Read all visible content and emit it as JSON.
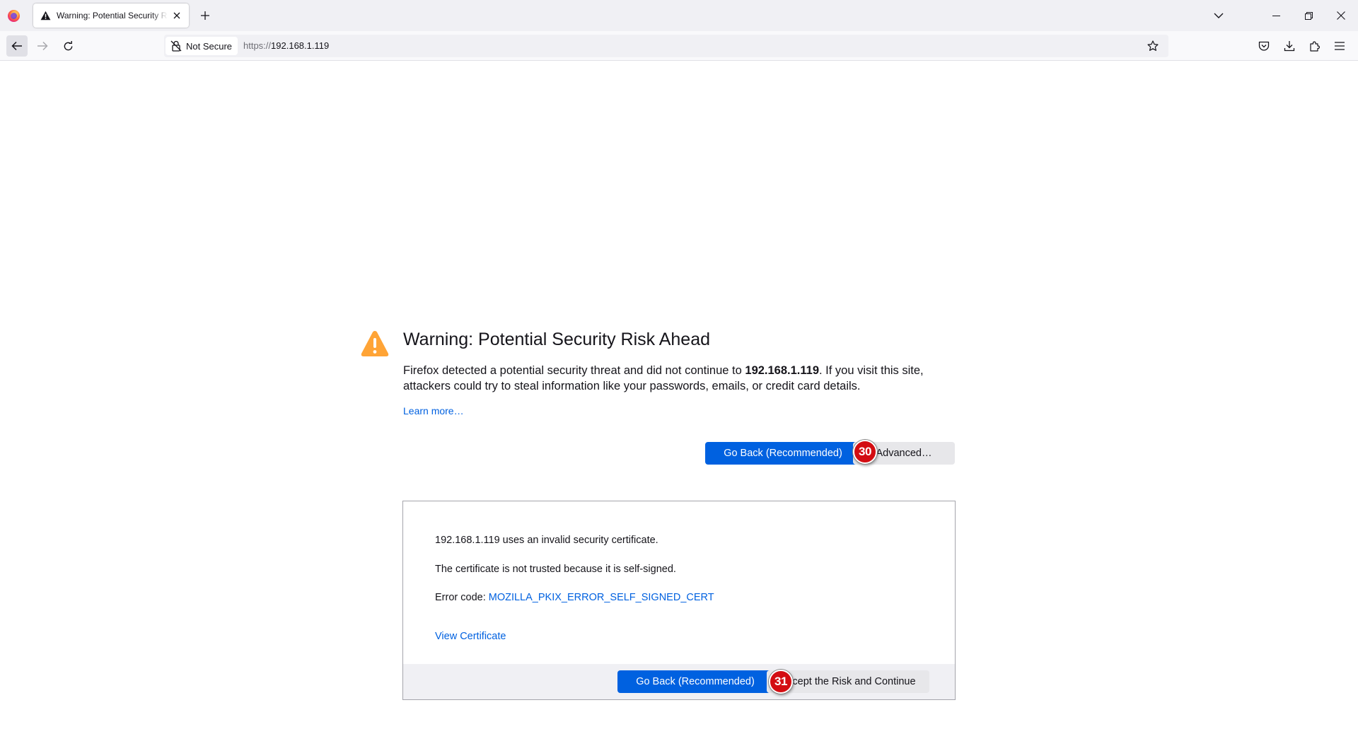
{
  "browser": {
    "tab_title": "Warning: Potential Security Risk Ahead",
    "new_tab_icon": "plus-icon",
    "url_scheme": "https://",
    "url_host": "192.168.1.119",
    "identity_label": "Not Secure"
  },
  "page": {
    "title": "Warning: Potential Security Risk Ahead",
    "desc_part1": "Firefox detected a potential security threat and did not continue to ",
    "desc_host": "192.168.1.119",
    "desc_part2": ". If you visit this site, attackers could try to steal information like your passwords, emails, or credit card details.",
    "learn_more": "Learn more…",
    "go_back_label": "Go Back (Recommended)",
    "advanced_label": "Advanced…",
    "badge_advanced": "30",
    "advanced_panel": {
      "line1": "192.168.1.119 uses an invalid security certificate.",
      "line2": "The certificate is not trusted because it is self-signed.",
      "error_code_label": "Error code: ",
      "error_code": "MOZILLA_PKIX_ERROR_SELF_SIGNED_CERT",
      "view_certificate": "View Certificate",
      "go_back_label": "Go Back (Recommended)",
      "accept_label": "Accept the Risk and Continue",
      "badge_accept": "31"
    }
  },
  "colors": {
    "primary_button": "#0061e0",
    "link": "#0061e0",
    "warning_icon": "#ffa436",
    "badge": "#d30d12"
  }
}
